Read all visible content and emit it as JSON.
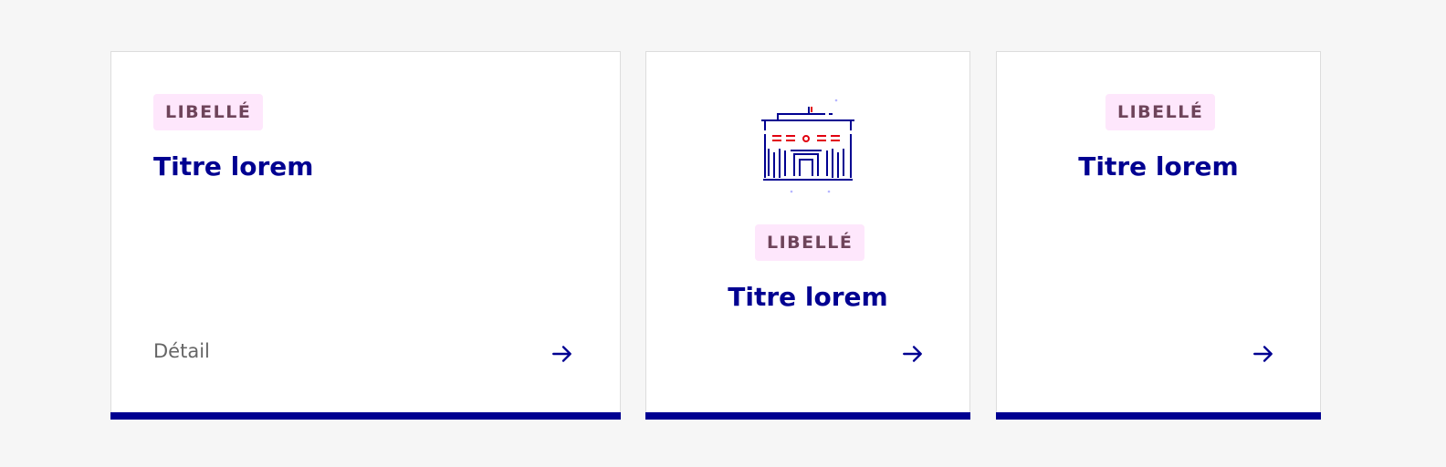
{
  "colors": {
    "background": "#f6f6f6",
    "card_background": "#ffffff",
    "card_border": "#dddddd",
    "accent_blue": "#000091",
    "badge_background": "#fee7fc",
    "badge_text": "#6e445a",
    "detail_text": "#666666",
    "pictogram_red": "#e1000f"
  },
  "tiles": [
    {
      "badge": "LIBELLÉ",
      "title": "Titre lorem",
      "detail": "Détail",
      "arrow_icon": "arrow-right-icon"
    },
    {
      "pictogram_icon": "city-hall-pictogram",
      "badge": "LIBELLÉ",
      "title": "Titre lorem",
      "arrow_icon": "arrow-right-icon"
    },
    {
      "badge": "LIBELLÉ",
      "title": "Titre lorem",
      "arrow_icon": "arrow-right-icon"
    }
  ]
}
